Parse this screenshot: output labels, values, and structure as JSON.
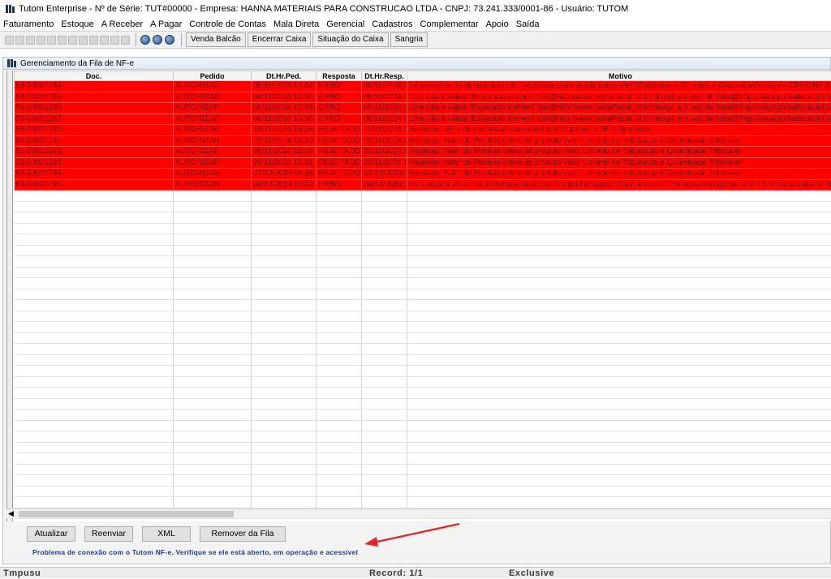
{
  "window": {
    "title": "Tutom Enterprise - Nº de Série: TUT#00000 - Empresa: HANNA MATERIAIS PARA CONSTRUCAO LTDA - CNPJ: 73.241.333/0001-86 - Usuário: TUTOM"
  },
  "menu": {
    "items": [
      "Faturamento",
      "Estoque",
      "A Receber",
      "A Pagar",
      "Controle de Contas",
      "Mala Direta",
      "Gerencial",
      "Cadastros",
      "Complementar",
      "Apoio",
      "Saída"
    ]
  },
  "toolbar": {
    "buttons": [
      "Venda Balcão",
      "Encerrar Caixa",
      "Situação do Caixa",
      "Sangria"
    ]
  },
  "panel": {
    "title": "Gerenciamento da Fila de NF-e"
  },
  "grid": {
    "columns": [
      "Doc.",
      "Pedido",
      "Dt.Hr.Ped.",
      "Resposta",
      "Dt.Hr.Resp.",
      "Motivo"
    ],
    "rows": [
      [
        "59-00001284",
        "AUTORIZAR",
        "05/11/2024 10:34",
        "ERRO",
        "05/11/2024 1",
        "Informações de destinatário não informada para venda com frete! (Cadastros > Clientes > Cobrança/Entrega > CPF/CNPJ)"
      ],
      [
        "59-00001285",
        "AUTORIZAR",
        "06/11/2024 10:36",
        "ERRO",
        "06/11/2024 1",
        "Lote não é válido !Esperado element 'det@http://www.portalfiscal.inf.br/nfe/g4' em vez de 'total@http://www.portalfiscal.inf.br/nfe/g4"
      ],
      [
        "59-00001286",
        "AUTORIZAR",
        "06/11/2024 10:49",
        "ERRO",
        "06/11/2024 1",
        "Lote não é válido !Esperado element 'det@http://www.portalfiscal.inf.br/nfe/g4' em vez de 'total@http://www.portalfiscal.inf.br/nfe/g4"
      ],
      [
        "59-00001287",
        "AUTORIZAR",
        "06/11/2024 10:50",
        "ERRO",
        "06/11/2024 1",
        "Lote não é válido !Esperado element 'det@http://www.portalfiscal.inf.br/nfe/g4' em vez de 'total@http://www.portalfiscal.inf.br/nfe/g4"
      ],
      [
        "59-00001289",
        "AUTORIZAR",
        "18/11/2024 14:25",
        "REJEITADO",
        "22/11/2024 1",
        "Rejeicao: NF-e de devolucao com valor total superior a NF-e devolvida"
      ],
      [
        "59-00001291",
        "AUTORIZAR",
        "29/11/2024 15:20",
        "REJEITADO",
        "29/11/2024 1",
        "Rejeicao: Valor do Produto difere do produto Valor Unitario de Tributacao e Quantidade Tributavel"
      ],
      [
        "59-00001292",
        "AUTORIZAR",
        "29/11/2024 15:28",
        "REJEITADO",
        "29/11/2024 1",
        "Rejeicao: Valor do Produto difere do produto Valor Unitario de Tributacao e Quantidade Tributavel"
      ],
      [
        "59-00001293",
        "AUTORIZAR",
        "29/11/2024 15:31",
        "REJEITADO",
        "29/11/2024 1",
        "Rejeicao: Valor do Produto difere do produto Valor Unitario de Tributacao e Quantidade Tributavel"
      ],
      [
        "59-00001294",
        "AUTORIZAR",
        "02/12/2024 15:48",
        "REJEITADO",
        "02/12/2024 1",
        "Rejeicao: Valor do Produto difere do produto Valor Unitario de Tributacao e Quantidade Tributavel"
      ],
      [
        "59-00001295",
        "AUTORIZAR",
        "04/12/2024 10:32",
        "ERRO",
        "04/12/2024 1",
        "Erro ao processar fila da NF:java.lang.NullPointerException: Cannot invoke \"String.isEmpty()\" because the return value of \"br.com."
      ]
    ]
  },
  "actions": {
    "atualizar": "Atualizar",
    "reenviar": "Reenviar",
    "xml": "XML",
    "remover": "Remover da Fila"
  },
  "message": "Problema de conexão com o Tutom NF-e. Verifique se ele está aberto, em operação e acessível",
  "statusbar": {
    "left": "Tmpusu",
    "record": "Record: 1/1",
    "mode": "Exclusive"
  },
  "colors": {
    "error_row": "#ff0000",
    "error_text": "#6a0b0b",
    "annotation_arrow": "#e0242a",
    "message_text": "#1e3f8f"
  }
}
